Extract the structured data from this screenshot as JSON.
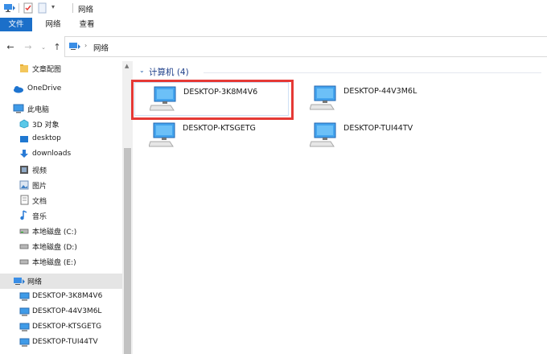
{
  "titlebar": {
    "title": "网络"
  },
  "ribbon": {
    "tabs": [
      "文件",
      "网络",
      "查看"
    ]
  },
  "address": {
    "path": "网络"
  },
  "sidebar": {
    "items": [
      {
        "label": "文章配图",
        "icon": "folder-icon"
      },
      {
        "label": "OneDrive",
        "icon": "cloud-icon"
      },
      {
        "label": "此电脑",
        "icon": "pc-icon"
      },
      {
        "label": "3D 对象",
        "icon": "cube-icon"
      },
      {
        "label": "desktop",
        "icon": "desktop-folder-icon"
      },
      {
        "label": "downloads",
        "icon": "download-arrow-icon"
      },
      {
        "label": "视频",
        "icon": "video-icon"
      },
      {
        "label": "图片",
        "icon": "picture-icon"
      },
      {
        "label": "文档",
        "icon": "document-icon"
      },
      {
        "label": "音乐",
        "icon": "music-icon"
      },
      {
        "label": "本地磁盘 (C:)",
        "icon": "drive-icon"
      },
      {
        "label": "本地磁盘 (D:)",
        "icon": "drive-icon"
      },
      {
        "label": "本地磁盘 (E:)",
        "icon": "drive-icon"
      },
      {
        "label": "网络",
        "icon": "network-icon"
      },
      {
        "label": "DESKTOP-3K8M4V6",
        "icon": "computer-icon"
      },
      {
        "label": "DESKTOP-44V3M6L",
        "icon": "computer-icon"
      },
      {
        "label": "DESKTOP-KTSGETG",
        "icon": "computer-icon"
      },
      {
        "label": "DESKTOP-TUI44TV",
        "icon": "computer-icon"
      }
    ]
  },
  "content": {
    "group_label": "计算机 (4)",
    "computers": [
      "DESKTOP-3K8M4V6",
      "DESKTOP-44V3M6L",
      "DESKTOP-KTSGETG",
      "DESKTOP-TUI44TV"
    ]
  },
  "colors": {
    "accent": "#1b6fc9",
    "highlight_box": "#e53935",
    "selected_row": "#e5e5e5"
  }
}
